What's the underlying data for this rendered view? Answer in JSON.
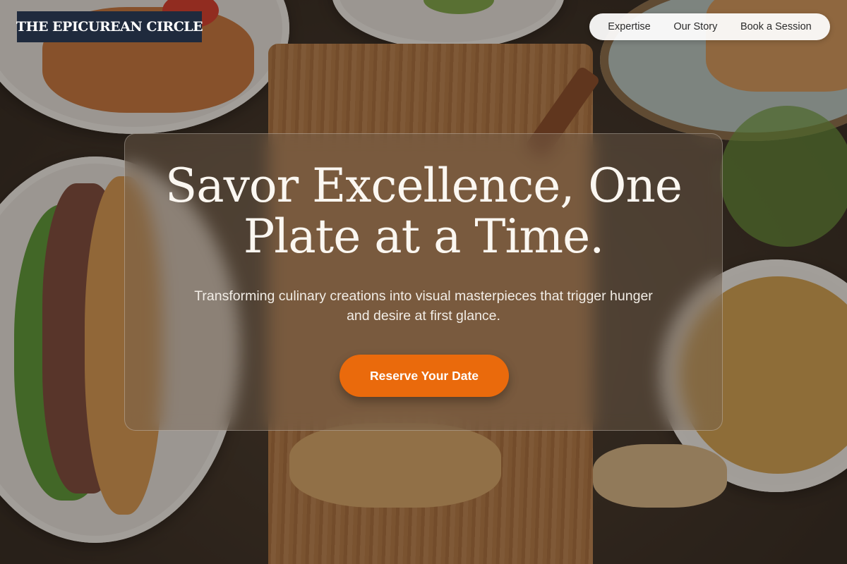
{
  "brand": {
    "logo_text": "THE EPICUREAN CIRCLE"
  },
  "nav": {
    "items": [
      {
        "label": "Expertise"
      },
      {
        "label": "Our Story"
      },
      {
        "label": "Book a Session"
      }
    ]
  },
  "hero": {
    "headline": "Savor Excellence, One Plate at a Time.",
    "subtitle": "Transforming culinary creations into visual masterpieces that trigger hunger and desire at first glance.",
    "cta_label": "Reserve Your Date"
  },
  "colors": {
    "accent": "#ea6a0c",
    "logo_bg": "#1f2a3d"
  },
  "background": {
    "image_description": "food-spread-background"
  }
}
